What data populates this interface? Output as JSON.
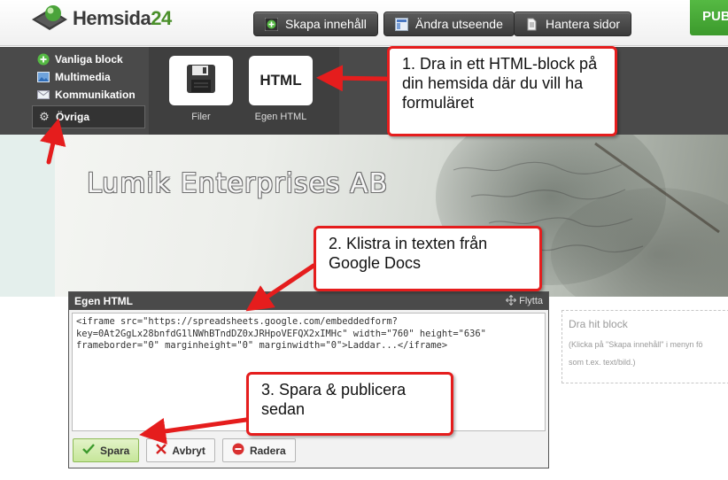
{
  "brand": {
    "name": "Hemsida",
    "number": "24"
  },
  "top_nav": [
    {
      "label": "Skapa innehåll",
      "icon": "plus-circle-icon"
    },
    {
      "label": "Ändra utseende",
      "icon": "layout-icon"
    },
    {
      "label": "Hantera sidor",
      "icon": "pages-icon"
    }
  ],
  "publish_label": "PUB",
  "categories": [
    {
      "label": "Vanliga block",
      "icon": "plus-circle-icon"
    },
    {
      "label": "Multimedia",
      "icon": "image-icon"
    },
    {
      "label": "Kommunikation",
      "icon": "envelope-icon"
    },
    {
      "label": "Övriga",
      "icon": "gear-icon"
    }
  ],
  "blocks": [
    {
      "label": "Filer",
      "icon": "floppy-disk-icon"
    },
    {
      "label": "Egen HTML",
      "tile_text": "HTML",
      "icon": "html-icon"
    }
  ],
  "site_title": "Lumik Enterprises AB",
  "editor": {
    "title": "Egen HTML",
    "move_label": "Flytta",
    "code": "<iframe src=\"https://spreadsheets.google.com/embeddedform?\nkey=0At2GgLx28bnfdG1lNWhBTndDZ0xJRHpoVEFQX2xIMHc\" width=\"760\" height=\"636\"\nframeborder=\"0\" marginheight=\"0\" marginwidth=\"0\">Laddar...</iframe>",
    "buttons": {
      "save": "Spara",
      "cancel": "Avbryt",
      "delete": "Radera"
    }
  },
  "drop_zone": {
    "title": "Dra hit block",
    "hint_line1": "(Klicka på \"Skapa innehåll\" i menyn fö",
    "hint_line2": "som t.ex. text/bild.)"
  },
  "callouts": {
    "step1": "1. Dra in ett HTML-block på din hemsida där du vill ha formuläret",
    "step2": "2. Klistra in texten från Google Docs",
    "step3": "3. Spara & publicera sedan"
  },
  "colors": {
    "accent": "#e51d1d",
    "publish": "#4aae38",
    "toolbar": "#4a4a4a"
  }
}
